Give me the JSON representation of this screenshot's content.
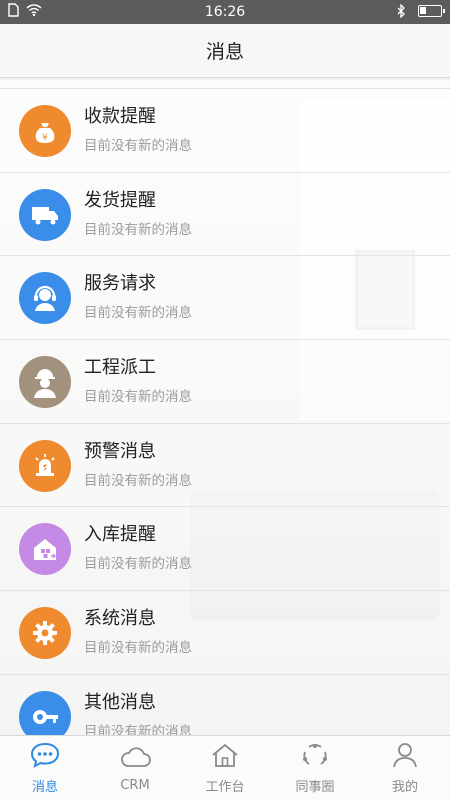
{
  "status_bar": {
    "time": "16:26",
    "left_icons": [
      "sim-icon",
      "wifi-icon"
    ],
    "right_icons": [
      "bluetooth-icon",
      "battery-icon"
    ]
  },
  "header": {
    "title": "消息"
  },
  "messages": [
    {
      "title": "收款提醒",
      "subtitle": "目前没有新的消息",
      "icon": "money-bag-icon",
      "color": "#f08a2e"
    },
    {
      "title": "发货提醒",
      "subtitle": "目前没有新的消息",
      "icon": "truck-icon",
      "color": "#3a8de8"
    },
    {
      "title": "服务请求",
      "subtitle": "目前没有新的消息",
      "icon": "headset-agent-icon",
      "color": "#3a8de8"
    },
    {
      "title": "工程派工",
      "subtitle": "目前没有新的消息",
      "icon": "worker-icon",
      "color": "#a1917d"
    },
    {
      "title": "预警消息",
      "subtitle": "目前没有新的消息",
      "icon": "alarm-icon",
      "color": "#f08a2e"
    },
    {
      "title": "入库提醒",
      "subtitle": "目前没有新的消息",
      "icon": "warehouse-icon",
      "color": "#c58ae6"
    },
    {
      "title": "系统消息",
      "subtitle": "目前没有新的消息",
      "icon": "gear-icon",
      "color": "#f08a2e"
    },
    {
      "title": "其他消息",
      "subtitle": "目前没有新的消息",
      "icon": "key-icon",
      "color": "#3a8de8"
    }
  ],
  "tabs": [
    {
      "label": "消息",
      "icon": "chat-bubble-icon",
      "active": true
    },
    {
      "label": "CRM",
      "icon": "cloud-icon",
      "active": false
    },
    {
      "label": "工作台",
      "icon": "home-icon",
      "active": false
    },
    {
      "label": "同事圈",
      "icon": "circle-dots-icon",
      "active": false
    },
    {
      "label": "我的",
      "icon": "person-icon",
      "active": false
    }
  ],
  "colors": {
    "accent": "#2f8be0",
    "status_bar": "#5c5c5c"
  }
}
